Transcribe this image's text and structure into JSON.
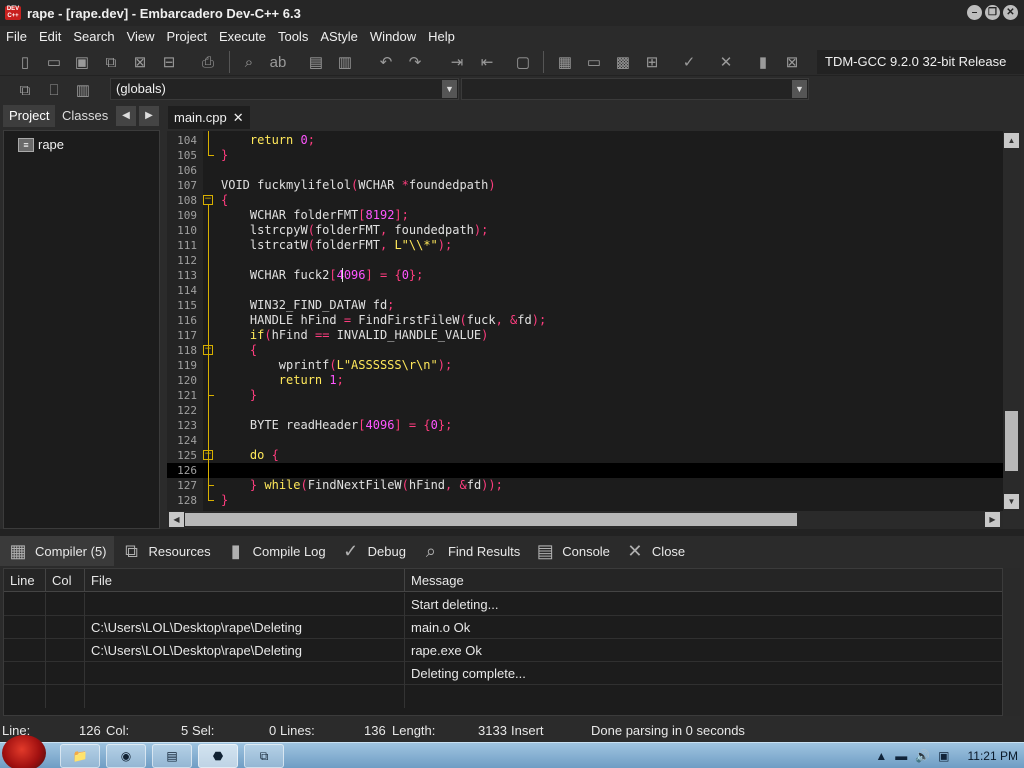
{
  "window": {
    "title": "rape - [rape.dev] - Embarcadero Dev-C++ 6.3",
    "app_icon_text": "DEV C++",
    "controls": [
      "–",
      "❐",
      "✕"
    ]
  },
  "menu": [
    "File",
    "Edit",
    "Search",
    "View",
    "Project",
    "Execute",
    "Tools",
    "AStyle",
    "Window",
    "Help"
  ],
  "toolbar": {
    "compiler": "TDM-GCC 9.2.0 32-bit Release"
  },
  "toolbar2": {
    "scope_combo": "(globals)",
    "function_combo": ""
  },
  "left_panel": {
    "tabs": [
      "Project",
      "Classes"
    ],
    "tree_root": "rape"
  },
  "editor": {
    "tab_label": "main.cpp",
    "tab_close": "✕",
    "lines": [
      {
        "n": "104",
        "text": "    return 0;"
      },
      {
        "n": "105",
        "text": "}"
      },
      {
        "n": "106",
        "text": ""
      },
      {
        "n": "107",
        "text": "VOID fuckmylifelol(WCHAR *foundedpath)"
      },
      {
        "n": "108",
        "text": "{"
      },
      {
        "n": "109",
        "text": "    WCHAR folderFMT[8192];"
      },
      {
        "n": "110",
        "text": "    lstrcpyW(folderFMT, foundedpath);"
      },
      {
        "n": "111",
        "text": "    lstrcatW(folderFMT, L\"\\\\*\");"
      },
      {
        "n": "112",
        "text": ""
      },
      {
        "n": "113",
        "text": "    WCHAR fuck2[4096] = {0};"
      },
      {
        "n": "114",
        "text": ""
      },
      {
        "n": "115",
        "text": "    WIN32_FIND_DATAW fd;"
      },
      {
        "n": "116",
        "text": "    HANDLE hFind = FindFirstFileW(fuck, &fd);"
      },
      {
        "n": "117",
        "text": "    if(hFind == INVALID_HANDLE_VALUE)"
      },
      {
        "n": "118",
        "text": "    {"
      },
      {
        "n": "119",
        "text": "        wprintf(L\"ASSSSSS\\r\\n\");"
      },
      {
        "n": "120",
        "text": "        return 1;"
      },
      {
        "n": "121",
        "text": "    }"
      },
      {
        "n": "122",
        "text": ""
      },
      {
        "n": "123",
        "text": "    BYTE readHeader[4096] = {0};"
      },
      {
        "n": "124",
        "text": ""
      },
      {
        "n": "125",
        "text": "    do {"
      },
      {
        "n": "126",
        "text": ""
      },
      {
        "n": "127",
        "text": "    } while(FindNextFileW(hFind, &fd));"
      },
      {
        "n": "128",
        "text": "}"
      }
    ]
  },
  "bottom_tabs": [
    {
      "label": "Compiler (5)",
      "icon": "compiler-grid-icon"
    },
    {
      "label": "Resources",
      "icon": "resources-icon"
    },
    {
      "label": "Compile Log",
      "icon": "bar-chart-icon"
    },
    {
      "label": "Debug",
      "icon": "check-icon"
    },
    {
      "label": "Find Results",
      "icon": "find-icon"
    },
    {
      "label": "Console",
      "icon": "console-icon"
    },
    {
      "label": "Close",
      "icon": "close-x-icon"
    }
  ],
  "messages": {
    "columns": [
      "Line",
      "Col",
      "File",
      "Message"
    ],
    "rows": [
      {
        "line": "",
        "col": "",
        "file": "",
        "message": "Start deleting..."
      },
      {
        "line": "",
        "col": "",
        "file": "C:\\Users\\LOL\\Desktop\\rape\\Deleting",
        "message": "main.o Ok"
      },
      {
        "line": "",
        "col": "",
        "file": "C:\\Users\\LOL\\Desktop\\rape\\Deleting",
        "message": "rape.exe Ok"
      },
      {
        "line": "",
        "col": "",
        "file": "",
        "message": "Deleting complete..."
      }
    ]
  },
  "status": {
    "line_label": "Line:",
    "line_value": "126",
    "col_label": "Col:",
    "col_value": "5",
    "sel_label": "Sel:",
    "sel_value": "0",
    "lines_label": "Lines:",
    "lines_value": "136",
    "length_label": "Length:",
    "length_value": "3133",
    "mode": "Insert",
    "parse_msg": "Done parsing in 0 seconds"
  },
  "taskbar": {
    "time": "11:21 PM"
  },
  "colors": {
    "keyword": "#ffe85a",
    "number": "#ff55ff",
    "punct": "#ff3d7f",
    "fold": "#d8b000"
  }
}
